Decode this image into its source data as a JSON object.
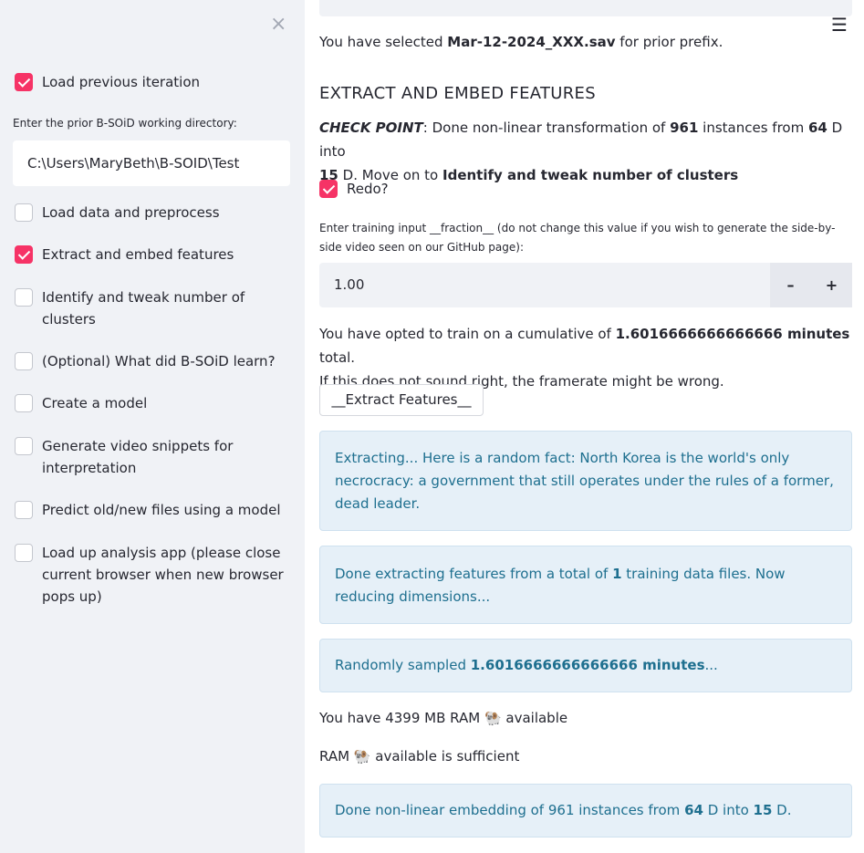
{
  "sidebar": {
    "close_icon": "×",
    "load_previous": "Load previous iteration",
    "dir_label": "Enter the prior B-SOiD working directory:",
    "dir_value": "C:\\Users\\MaryBeth\\B-SOID\\Test",
    "steps": [
      {
        "label": "Load data and preprocess",
        "checked": false
      },
      {
        "label": "Extract and embed features",
        "checked": true
      },
      {
        "label": "Identify and tweak number of clusters",
        "checked": false
      },
      {
        "label": "(Optional) What did B-SOiD learn?",
        "checked": false
      },
      {
        "label": "Create a model",
        "checked": false
      },
      {
        "label": "Generate video snippets for interpretation",
        "checked": false
      },
      {
        "label": "Predict old/new files using a model",
        "checked": false
      },
      {
        "label": "Load up analysis app (please close current browser when new browser pops up)",
        "checked": false
      }
    ]
  },
  "main": {
    "menu_icon": "☰",
    "selected_prefix": "You have selected ",
    "selected_file": "Mar-12-2024_XXX.sav",
    "selected_suffix": " for prior prefix.",
    "heading": "EXTRACT AND EMBED FEATURES",
    "checkpoint_label": "CHECK POINT",
    "checkpoint_t1": ": Done non-linear transformation of ",
    "checkpoint_instances": "961",
    "checkpoint_t2": " instances from ",
    "checkpoint_from_dim": "64",
    "checkpoint_t3": " D into",
    "checkpoint_to_dim": "15",
    "checkpoint_t4": " D. Move on to ",
    "checkpoint_next": "Identify and tweak number of clusters",
    "redo_label": "Redo?",
    "fraction_label": "Enter training input __fraction__ (do not change this value if you wish to generate the side-by-side video seen on our GitHub page):",
    "fraction_value": "1.00",
    "minus": "–",
    "plus": "+",
    "train_t1": "You have opted to train on a cumulative of ",
    "train_minutes": "1.6016666666666666 minutes",
    "train_t2": " total.",
    "train_t3": "If this does not sound right, the framerate might be wrong.",
    "extract_button": "__Extract Features__",
    "alert1": "Extracting... Here is a random fact: North Korea is the world's only necrocracy: a government that still operates under the rules of a former, dead leader.",
    "alert2_t1": "Done extracting features from a total of ",
    "alert2_count": "1",
    "alert2_t2": " training data files. Now reducing dimensions...",
    "alert3_t1": "Randomly sampled ",
    "alert3_minutes": "1.6016666666666666 minutes",
    "alert3_t2": "...",
    "ram1_t1": "You have 4399 MB RAM ",
    "ram_emoji": "🐏",
    "ram1_t2": " available",
    "ram2_t1": "RAM ",
    "ram2_t2": " available is sufficient",
    "alert4_t1": "Done non-linear embedding of 961 instances from ",
    "alert4_from": "64",
    "alert4_t2": " D into ",
    "alert4_to": "15",
    "alert4_t3": " D."
  }
}
